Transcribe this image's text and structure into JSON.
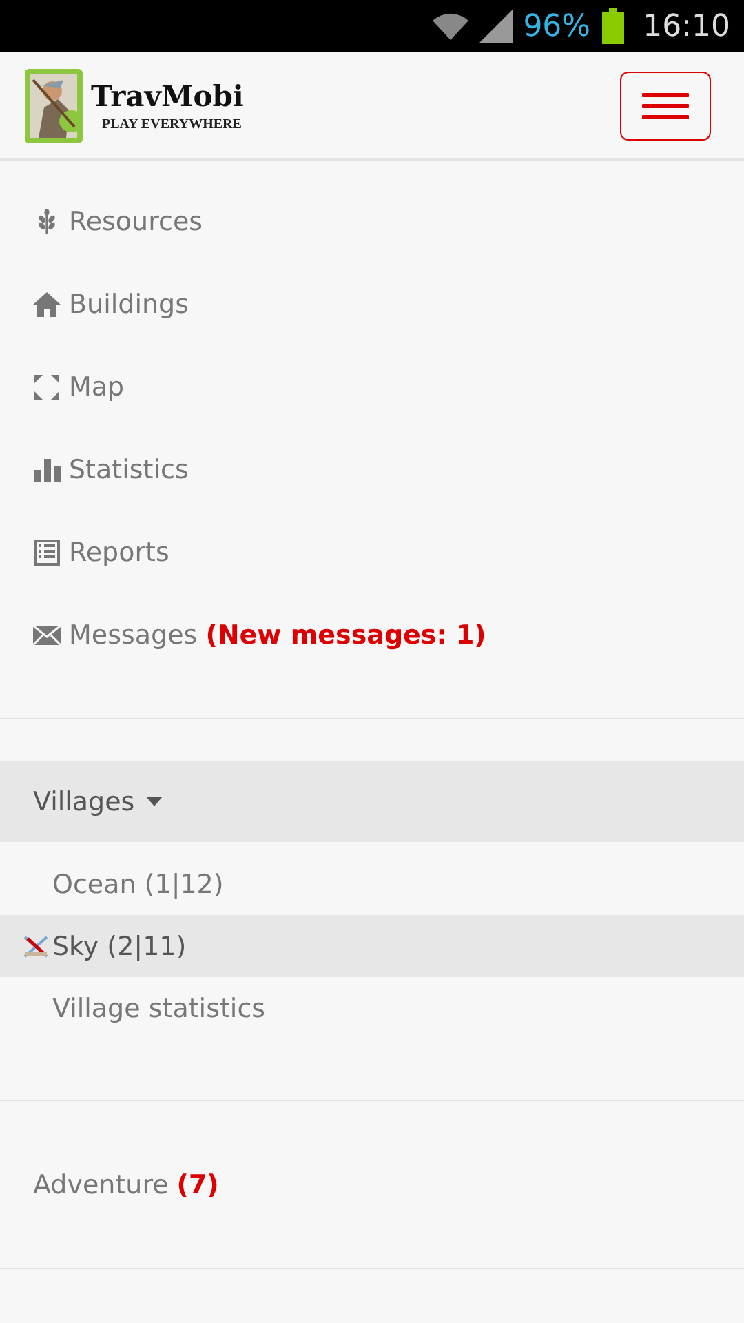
{
  "status_bar": {
    "battery_text": "96%",
    "time": "16:10"
  },
  "header": {
    "title": "TravMobi",
    "tagline": "PLAY EVERYWHERE"
  },
  "menu": [
    {
      "kind": "resources",
      "label": "Resources"
    },
    {
      "kind": "buildings",
      "label": "Buildings"
    },
    {
      "kind": "map",
      "label": "Map"
    },
    {
      "kind": "statistics",
      "label": "Statistics"
    },
    {
      "kind": "reports",
      "label": "Reports"
    },
    {
      "kind": "messages",
      "label": "Messages",
      "badge": "(New messages: 1)"
    }
  ],
  "villages": {
    "label": "Villages",
    "expanded": true,
    "items": [
      {
        "label": "Ocean (1|12)",
        "selected": false,
        "under_attack": false
      },
      {
        "label": "Sky (2|11)",
        "selected": true,
        "under_attack": true
      },
      {
        "label": "Village statistics",
        "selected": false,
        "under_attack": false
      }
    ]
  },
  "adventure": {
    "label": "Adventure",
    "badge": "(7)"
  }
}
